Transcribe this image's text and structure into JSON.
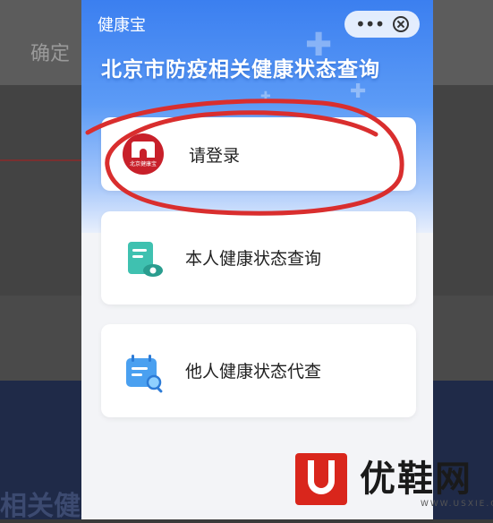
{
  "background": {
    "confirm_label": "确定",
    "bottom_text": "相关健康"
  },
  "header": {
    "app_name": "健康宝",
    "more_icon": "more-dots-icon",
    "close_icon": "close-circle-icon"
  },
  "page_title": "北京市防疫相关健康状态查询",
  "cards": {
    "login": {
      "label": "请登录",
      "logo_text": "北京健康宝"
    },
    "self": {
      "label": "本人健康状态查询",
      "icon": "document-eye-icon"
    },
    "other": {
      "label": "他人健康状态代查",
      "icon": "calendar-search-icon"
    }
  },
  "watermark": {
    "brand": "优鞋网",
    "url": "WWW.USXIE.COM",
    "accent": "#d9261c"
  },
  "colors": {
    "hero_blue": "#3b7ff0",
    "annotation_red": "#d92e2e",
    "icon_teal": "#33b5a8"
  }
}
